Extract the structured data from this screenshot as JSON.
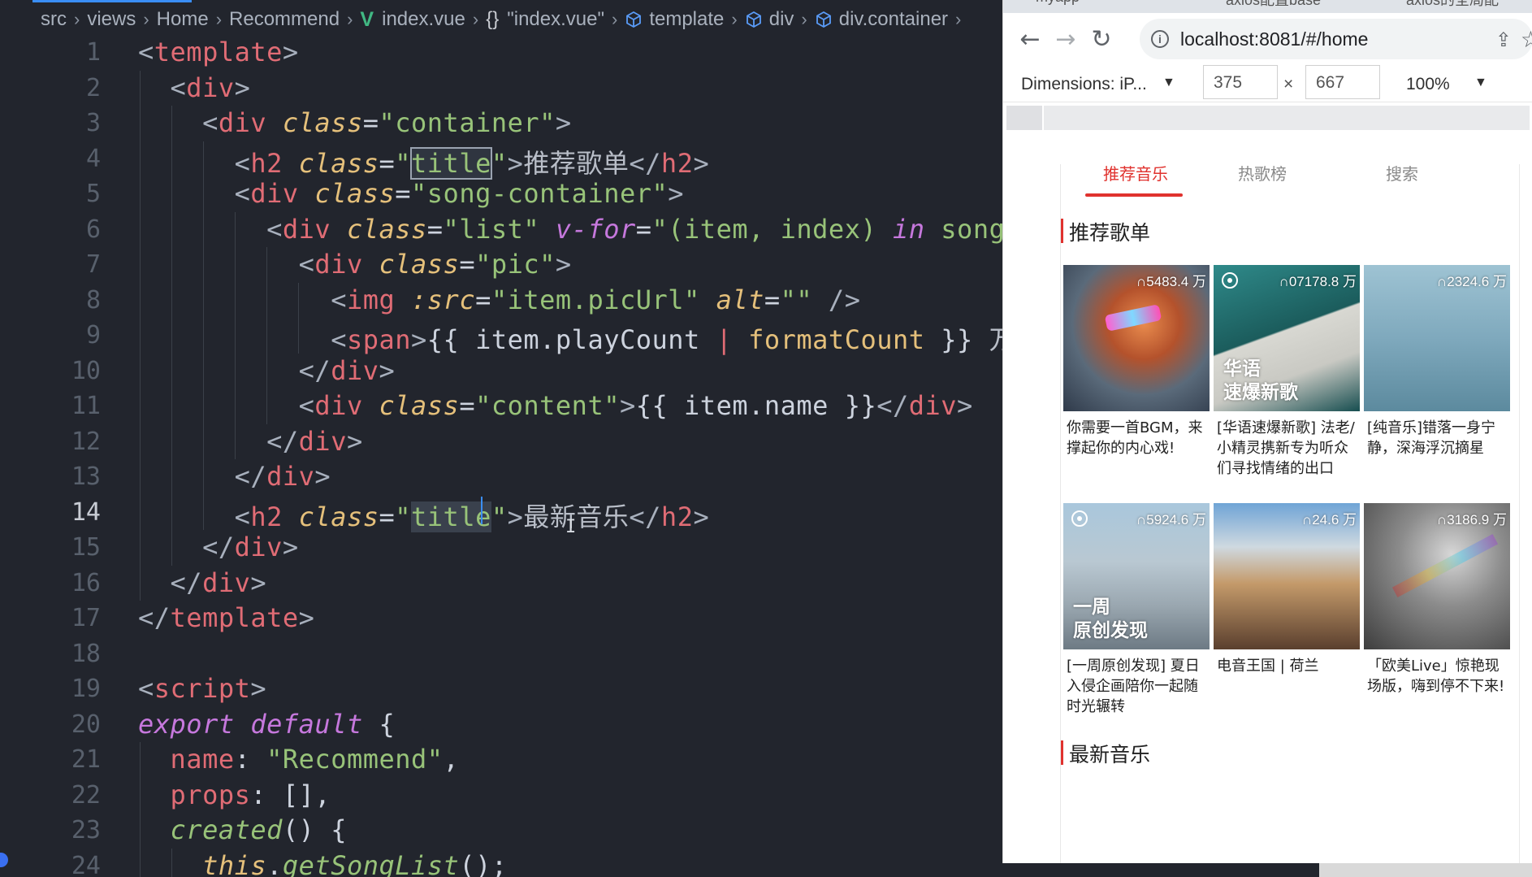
{
  "editor": {
    "breadcrumb": [
      "src",
      "views",
      "Home",
      "Recommend",
      "index.vue",
      "\"index.vue\"",
      "template",
      "div",
      "div.container"
    ],
    "active_line": 14
  },
  "browser": {
    "tabs": [
      "myapp",
      "axios配置base",
      "axios的全局配"
    ],
    "url": "localhost:8081/#/home",
    "device": {
      "dimensions_label": "Dimensions: iP...",
      "width": "375",
      "height": "667",
      "times": "×",
      "zoom": "100%"
    }
  },
  "app": {
    "tabs": [
      "推荐音乐",
      "热歌榜",
      "搜索"
    ],
    "sections": {
      "recommend_title": "推荐歌单",
      "newsong_title": "最新音乐"
    },
    "playlists": [
      {
        "count": "5483.4 万",
        "name": "你需要一首BGM，来撑起你的内心戏!",
        "overlay": "",
        "radio": false
      },
      {
        "count": "07178.8 万",
        "name": "[华语速爆新歌] 法老/小精灵携新专为听众们寻找情绪的出口",
        "overlay": "华语\n速爆新歌",
        "radio": true
      },
      {
        "count": "2324.6 万",
        "name": "[纯音乐]错落一身宁静，深海浮沉摘星",
        "overlay": "",
        "radio": false
      },
      {
        "count": "5924.6 万",
        "name": "[一周原创发现] 夏日入侵企画陪你一起随时光辗转",
        "overlay": "一周\n原创发现",
        "radio": true
      },
      {
        "count": "24.6 万",
        "name": "电音王国 | 荷兰",
        "overlay": "",
        "radio": false
      },
      {
        "count": "3186.9 万",
        "name": "「欧美Live」惊艳现场版，嗨到停不下来!",
        "overlay": "",
        "radio": false
      }
    ]
  },
  "colors": {
    "accent": "#e0322e",
    "editor_bg": "#22252d",
    "tag": "#e06c75",
    "attr": "#e5c07b",
    "string": "#98c379",
    "keyword": "#c678dd"
  }
}
